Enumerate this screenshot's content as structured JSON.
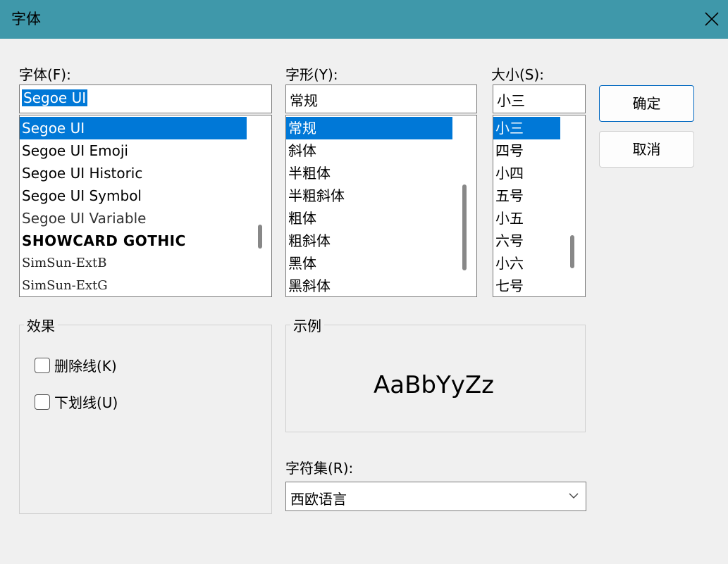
{
  "dialog": {
    "title": "字体"
  },
  "font": {
    "label": "字体(F):",
    "value": "Segoe UI",
    "items": [
      "Segoe UI",
      "Segoe UI Emoji",
      "Segoe UI Historic",
      "Segoe UI Symbol",
      "Segoe UI Variable",
      "SHOWCARD GOTHIC",
      "SimSun-ExtB",
      "SimSun-ExtG"
    ],
    "selected": "Segoe UI"
  },
  "style": {
    "label": "字形(Y):",
    "value": "常规",
    "items": [
      "常规",
      "斜体",
      "半粗体",
      "半粗斜体",
      "粗体",
      "粗斜体",
      "黑体",
      "黑斜体"
    ],
    "selected": "常规"
  },
  "size": {
    "label": "大小(S):",
    "value": "小三",
    "items": [
      "小三",
      "四号",
      "小四",
      "五号",
      "小五",
      "六号",
      "小六",
      "七号"
    ],
    "selected": "小三"
  },
  "buttons": {
    "ok": "确定",
    "cancel": "取消"
  },
  "effects": {
    "label": "效果",
    "strikeout": "删除线(K)",
    "underline": "下划线(U)"
  },
  "sample": {
    "label": "示例",
    "text": "AaBbYyZz"
  },
  "charset": {
    "label": "字符集(R):",
    "value": "西欧语言"
  },
  "colors": {
    "titlebar": "#3f98aa",
    "selection": "#0078d7"
  }
}
